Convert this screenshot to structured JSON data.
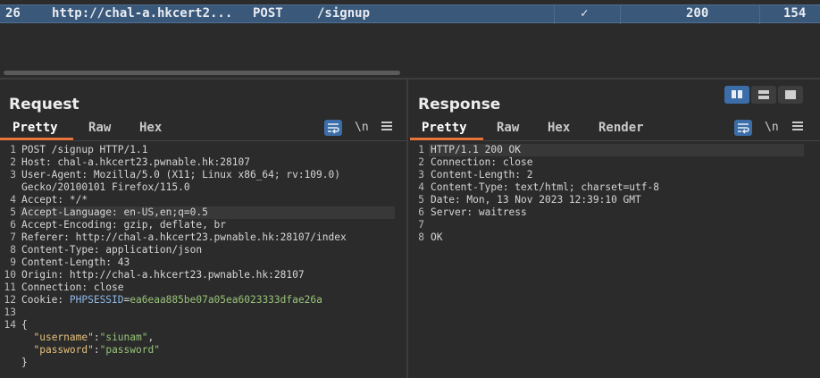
{
  "history": {
    "row": {
      "id": "26",
      "host": "http://chal-a.hkcert2...",
      "method": "POST",
      "path": "/signup",
      "check": "✓",
      "status": "200",
      "length": "154"
    }
  },
  "request": {
    "title": "Request",
    "tabs": [
      "Pretty",
      "Raw",
      "Hex"
    ],
    "newline_label": "\\n",
    "lines": [
      {
        "n": "1",
        "segments": [
          {
            "t": "POST /signup HTTP/1.1",
            "c": ""
          }
        ]
      },
      {
        "n": "2",
        "segments": [
          {
            "t": "Host: chal-a.hkcert23.pwnable.hk:28107",
            "c": ""
          }
        ]
      },
      {
        "n": "3",
        "segments": [
          {
            "t": "User-Agent: Mozilla/5.0 (X11; Linux x86_64; rv:109.0)",
            "c": ""
          }
        ]
      },
      {
        "n": "",
        "segments": [
          {
            "t": "Gecko/20100101 Firefox/115.0",
            "c": ""
          }
        ]
      },
      {
        "n": "4",
        "segments": [
          {
            "t": "Accept: */*",
            "c": ""
          }
        ]
      },
      {
        "n": "5",
        "segments": [
          {
            "t": "Accept-Language: en-US,en;q=0.5",
            "c": ""
          }
        ],
        "highlight": true
      },
      {
        "n": "6",
        "segments": [
          {
            "t": "Accept-Encoding: gzip, deflate, br",
            "c": ""
          }
        ]
      },
      {
        "n": "7",
        "segments": [
          {
            "t": "Referer: http://chal-a.hkcert23.pwnable.hk:28107/index",
            "c": ""
          }
        ]
      },
      {
        "n": "8",
        "segments": [
          {
            "t": "Content-Type: application/json",
            "c": ""
          }
        ]
      },
      {
        "n": "9",
        "segments": [
          {
            "t": "Content-Length: 43",
            "c": ""
          }
        ]
      },
      {
        "n": "10",
        "segments": [
          {
            "t": "Origin: http://chal-a.hkcert23.pwnable.hk:28107",
            "c": ""
          }
        ]
      },
      {
        "n": "11",
        "segments": [
          {
            "t": "Connection: close",
            "c": ""
          }
        ]
      },
      {
        "n": "12",
        "segments": [
          {
            "t": "Cookie: ",
            "c": ""
          },
          {
            "t": "PHPSESSID",
            "c": "c-blue"
          },
          {
            "t": "=",
            "c": ""
          },
          {
            "t": "ea6eaa885be07a05ea6023333dfae26a",
            "c": "c-green"
          }
        ]
      },
      {
        "n": "13",
        "segments": [
          {
            "t": "",
            "c": ""
          }
        ]
      },
      {
        "n": "14",
        "segments": [
          {
            "t": "{",
            "c": ""
          }
        ]
      },
      {
        "n": "",
        "segments": [
          {
            "t": "  ",
            "c": ""
          },
          {
            "t": "\"username\"",
            "c": "c-yellow"
          },
          {
            "t": ":",
            "c": ""
          },
          {
            "t": "\"siunam\"",
            "c": "c-green"
          },
          {
            "t": ",",
            "c": ""
          }
        ]
      },
      {
        "n": "",
        "segments": [
          {
            "t": "  ",
            "c": ""
          },
          {
            "t": "\"password\"",
            "c": "c-yellow"
          },
          {
            "t": ":",
            "c": ""
          },
          {
            "t": "\"password\"",
            "c": "c-green"
          }
        ]
      },
      {
        "n": "",
        "segments": [
          {
            "t": "}",
            "c": ""
          }
        ]
      }
    ]
  },
  "response": {
    "title": "Response",
    "tabs": [
      "Pretty",
      "Raw",
      "Hex",
      "Render"
    ],
    "newline_label": "\\n",
    "lines": [
      {
        "n": "1",
        "segments": [
          {
            "t": "HTTP/1.1 200 OK",
            "c": ""
          }
        ],
        "highlight": true
      },
      {
        "n": "2",
        "segments": [
          {
            "t": "Connection: close",
            "c": ""
          }
        ]
      },
      {
        "n": "3",
        "segments": [
          {
            "t": "Content-Length: 2",
            "c": ""
          }
        ]
      },
      {
        "n": "4",
        "segments": [
          {
            "t": "Content-Type: text/html; charset=utf-8",
            "c": ""
          }
        ]
      },
      {
        "n": "5",
        "segments": [
          {
            "t": "Date: Mon, 13 Nov 2023 12:39:10 GMT",
            "c": ""
          }
        ]
      },
      {
        "n": "6",
        "segments": [
          {
            "t": "Server: waitress",
            "c": ""
          }
        ]
      },
      {
        "n": "7",
        "segments": [
          {
            "t": "",
            "c": ""
          }
        ]
      },
      {
        "n": "8",
        "segments": [
          {
            "t": "OK",
            "c": ""
          }
        ]
      }
    ]
  },
  "colors": {
    "selected_row": "#3a587a",
    "accent_tab": "#e8743b",
    "button_blue": "#3b6ea8"
  },
  "icons": {
    "wrap": "word-wrap-icon",
    "menu": "hamburger-menu-icon",
    "layouts": [
      "side-by-side-layout-icon",
      "stacked-layout-icon",
      "single-tab-layout-icon"
    ]
  }
}
